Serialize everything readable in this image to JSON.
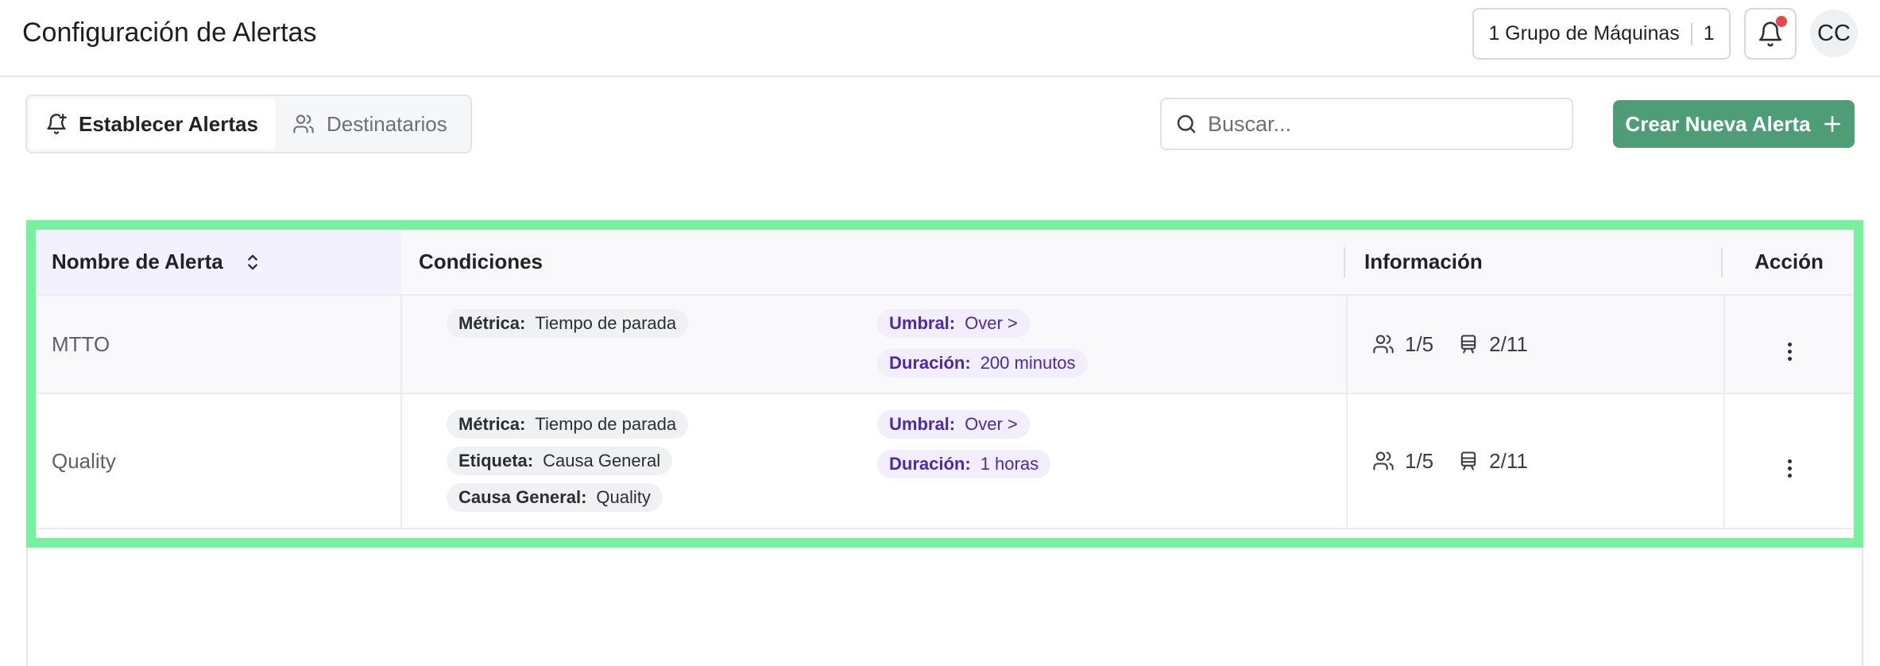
{
  "header": {
    "title": "Configuración de Alertas",
    "machine_group_label": "1 Grupo de Máquinas",
    "machine_group_count": "1",
    "avatar_initials": "CC"
  },
  "tabs": [
    {
      "label": "Establecer Alertas",
      "icon": "bell-plus-icon",
      "active": true
    },
    {
      "label": "Destinatarios",
      "icon": "users-icon",
      "active": false
    }
  ],
  "search": {
    "placeholder": "Buscar..."
  },
  "create_button": {
    "label": "Crear Nueva Alerta"
  },
  "table": {
    "columns": [
      "Nombre de Alerta",
      "Condiciones",
      "Información",
      "Acción"
    ],
    "rows": [
      {
        "name": "MTTO",
        "conditions_left": [
          {
            "key": "Métrica:",
            "value": "Tiempo de parada"
          }
        ],
        "conditions_right": [
          {
            "key": "Umbral:",
            "value": "Over >"
          },
          {
            "key": "Duración:",
            "value": "200 minutos"
          }
        ],
        "recipients": "1/5",
        "machines": "2/11"
      },
      {
        "name": "Quality",
        "conditions_left": [
          {
            "key": "Métrica:",
            "value": "Tiempo de parada"
          },
          {
            "key": "Etiqueta:",
            "value": "Causa General"
          },
          {
            "key": "Causa General:",
            "value": "Quality"
          }
        ],
        "conditions_right": [
          {
            "key": "Umbral:",
            "value": "Over >"
          },
          {
            "key": "Duración:",
            "value": "1 horas"
          }
        ],
        "recipients": "1/5",
        "machines": "2/11"
      }
    ]
  },
  "colors": {
    "primary_green": "#4e9d77",
    "highlight_border": "#76f29e",
    "notification_dot": "#e5484d",
    "pill_purple_text": "#4b2aa8"
  }
}
